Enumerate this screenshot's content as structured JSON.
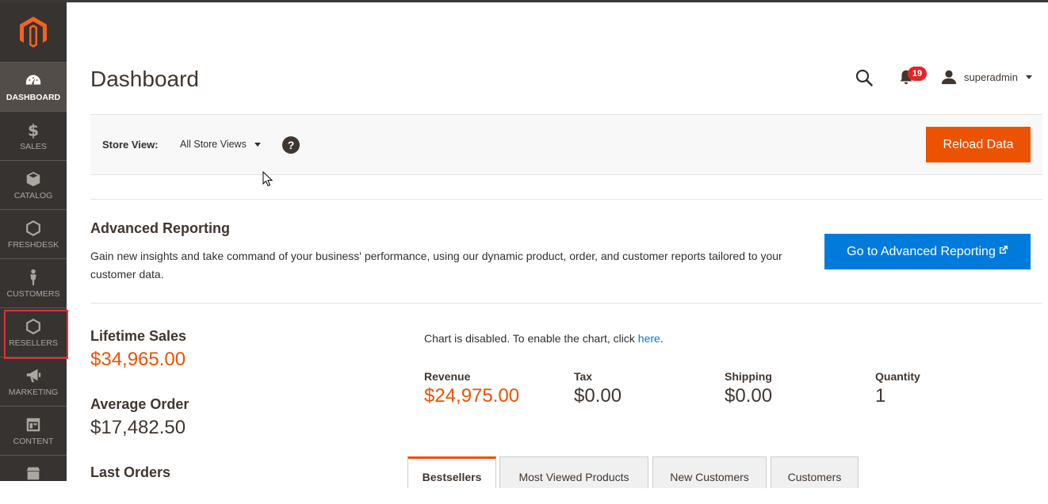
{
  "sidebar": {
    "items": [
      {
        "label": "DASHBOARD",
        "icon": "dashboard-icon"
      },
      {
        "label": "SALES",
        "icon": "dollar-icon"
      },
      {
        "label": "CATALOG",
        "icon": "box-icon"
      },
      {
        "label": "FRESHDESK",
        "icon": "hexagon-icon"
      },
      {
        "label": "CUSTOMERS",
        "icon": "person-icon"
      },
      {
        "label": "RESELLERS",
        "icon": "hexagon-icon"
      },
      {
        "label": "MARKETING",
        "icon": "megaphone-icon"
      },
      {
        "label": "CONTENT",
        "icon": "layout-icon"
      }
    ]
  },
  "header": {
    "title": "Dashboard",
    "notification_count": "19",
    "user_name": "superadmin"
  },
  "store_bar": {
    "label": "Store View:",
    "selected": "All Store Views",
    "help": "?",
    "reload_label": "Reload Data"
  },
  "advanced_reporting": {
    "title": "Advanced Reporting",
    "description": "Gain new insights and take command of your business' performance, using our dynamic product, order, and customer reports tailored to your customer data.",
    "button_label": "Go to Advanced Reporting"
  },
  "stats": {
    "lifetime_sales_label": "Lifetime Sales",
    "lifetime_sales_value": "$34,965.00",
    "average_order_label": "Average Order",
    "average_order_value": "$17,482.50",
    "last_orders_label": "Last Orders"
  },
  "chart_note": {
    "text": "Chart is disabled. To enable the chart, click ",
    "link": "here",
    "suffix": "."
  },
  "totals": [
    {
      "label": "Revenue",
      "value": "$24,975.00"
    },
    {
      "label": "Tax",
      "value": "$0.00"
    },
    {
      "label": "Shipping",
      "value": "$0.00"
    },
    {
      "label": "Quantity",
      "value": "1"
    }
  ],
  "tabs": [
    {
      "label": "Bestsellers",
      "active": true
    },
    {
      "label": "Most Viewed Products",
      "active": false
    },
    {
      "label": "New Customers",
      "active": false
    },
    {
      "label": "Customers",
      "active": false
    }
  ],
  "colors": {
    "sidebar_bg": "#373330",
    "accent_orange": "#eb5202",
    "link_blue": "#007bdb"
  }
}
